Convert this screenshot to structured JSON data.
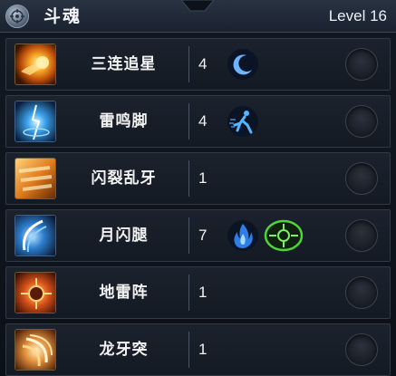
{
  "header": {
    "title": "斗魂",
    "level": "Level 16",
    "icon": "soul-emblem-icon"
  },
  "skills": [
    {
      "name": "三连追星",
      "rank": "4",
      "icon": "fire-punch-icon",
      "modifiers": [
        "crescent-moon-icon"
      ]
    },
    {
      "name": "雷鸣脚",
      "rank": "4",
      "icon": "lightning-kick-icon",
      "modifiers": [
        "running-figure-icon"
      ]
    },
    {
      "name": "闪裂乱牙",
      "rank": "1",
      "icon": "flurry-fists-icon",
      "modifiers": []
    },
    {
      "name": "月闪腿",
      "rank": "7",
      "icon": "crescent-kick-icon",
      "modifiers": [
        "blue-flame-icon",
        "green-target-icon"
      ]
    },
    {
      "name": "地雷阵",
      "rank": "1",
      "icon": "landmine-field-icon",
      "modifiers": []
    },
    {
      "name": "龙牙突",
      "rank": "1",
      "icon": "dragon-fang-icon",
      "modifiers": []
    }
  ],
  "colors": {
    "row_bg": "#1b222d",
    "row_border": "#303a47",
    "header_bg": "#283241",
    "text": "#f2f2f2"
  }
}
